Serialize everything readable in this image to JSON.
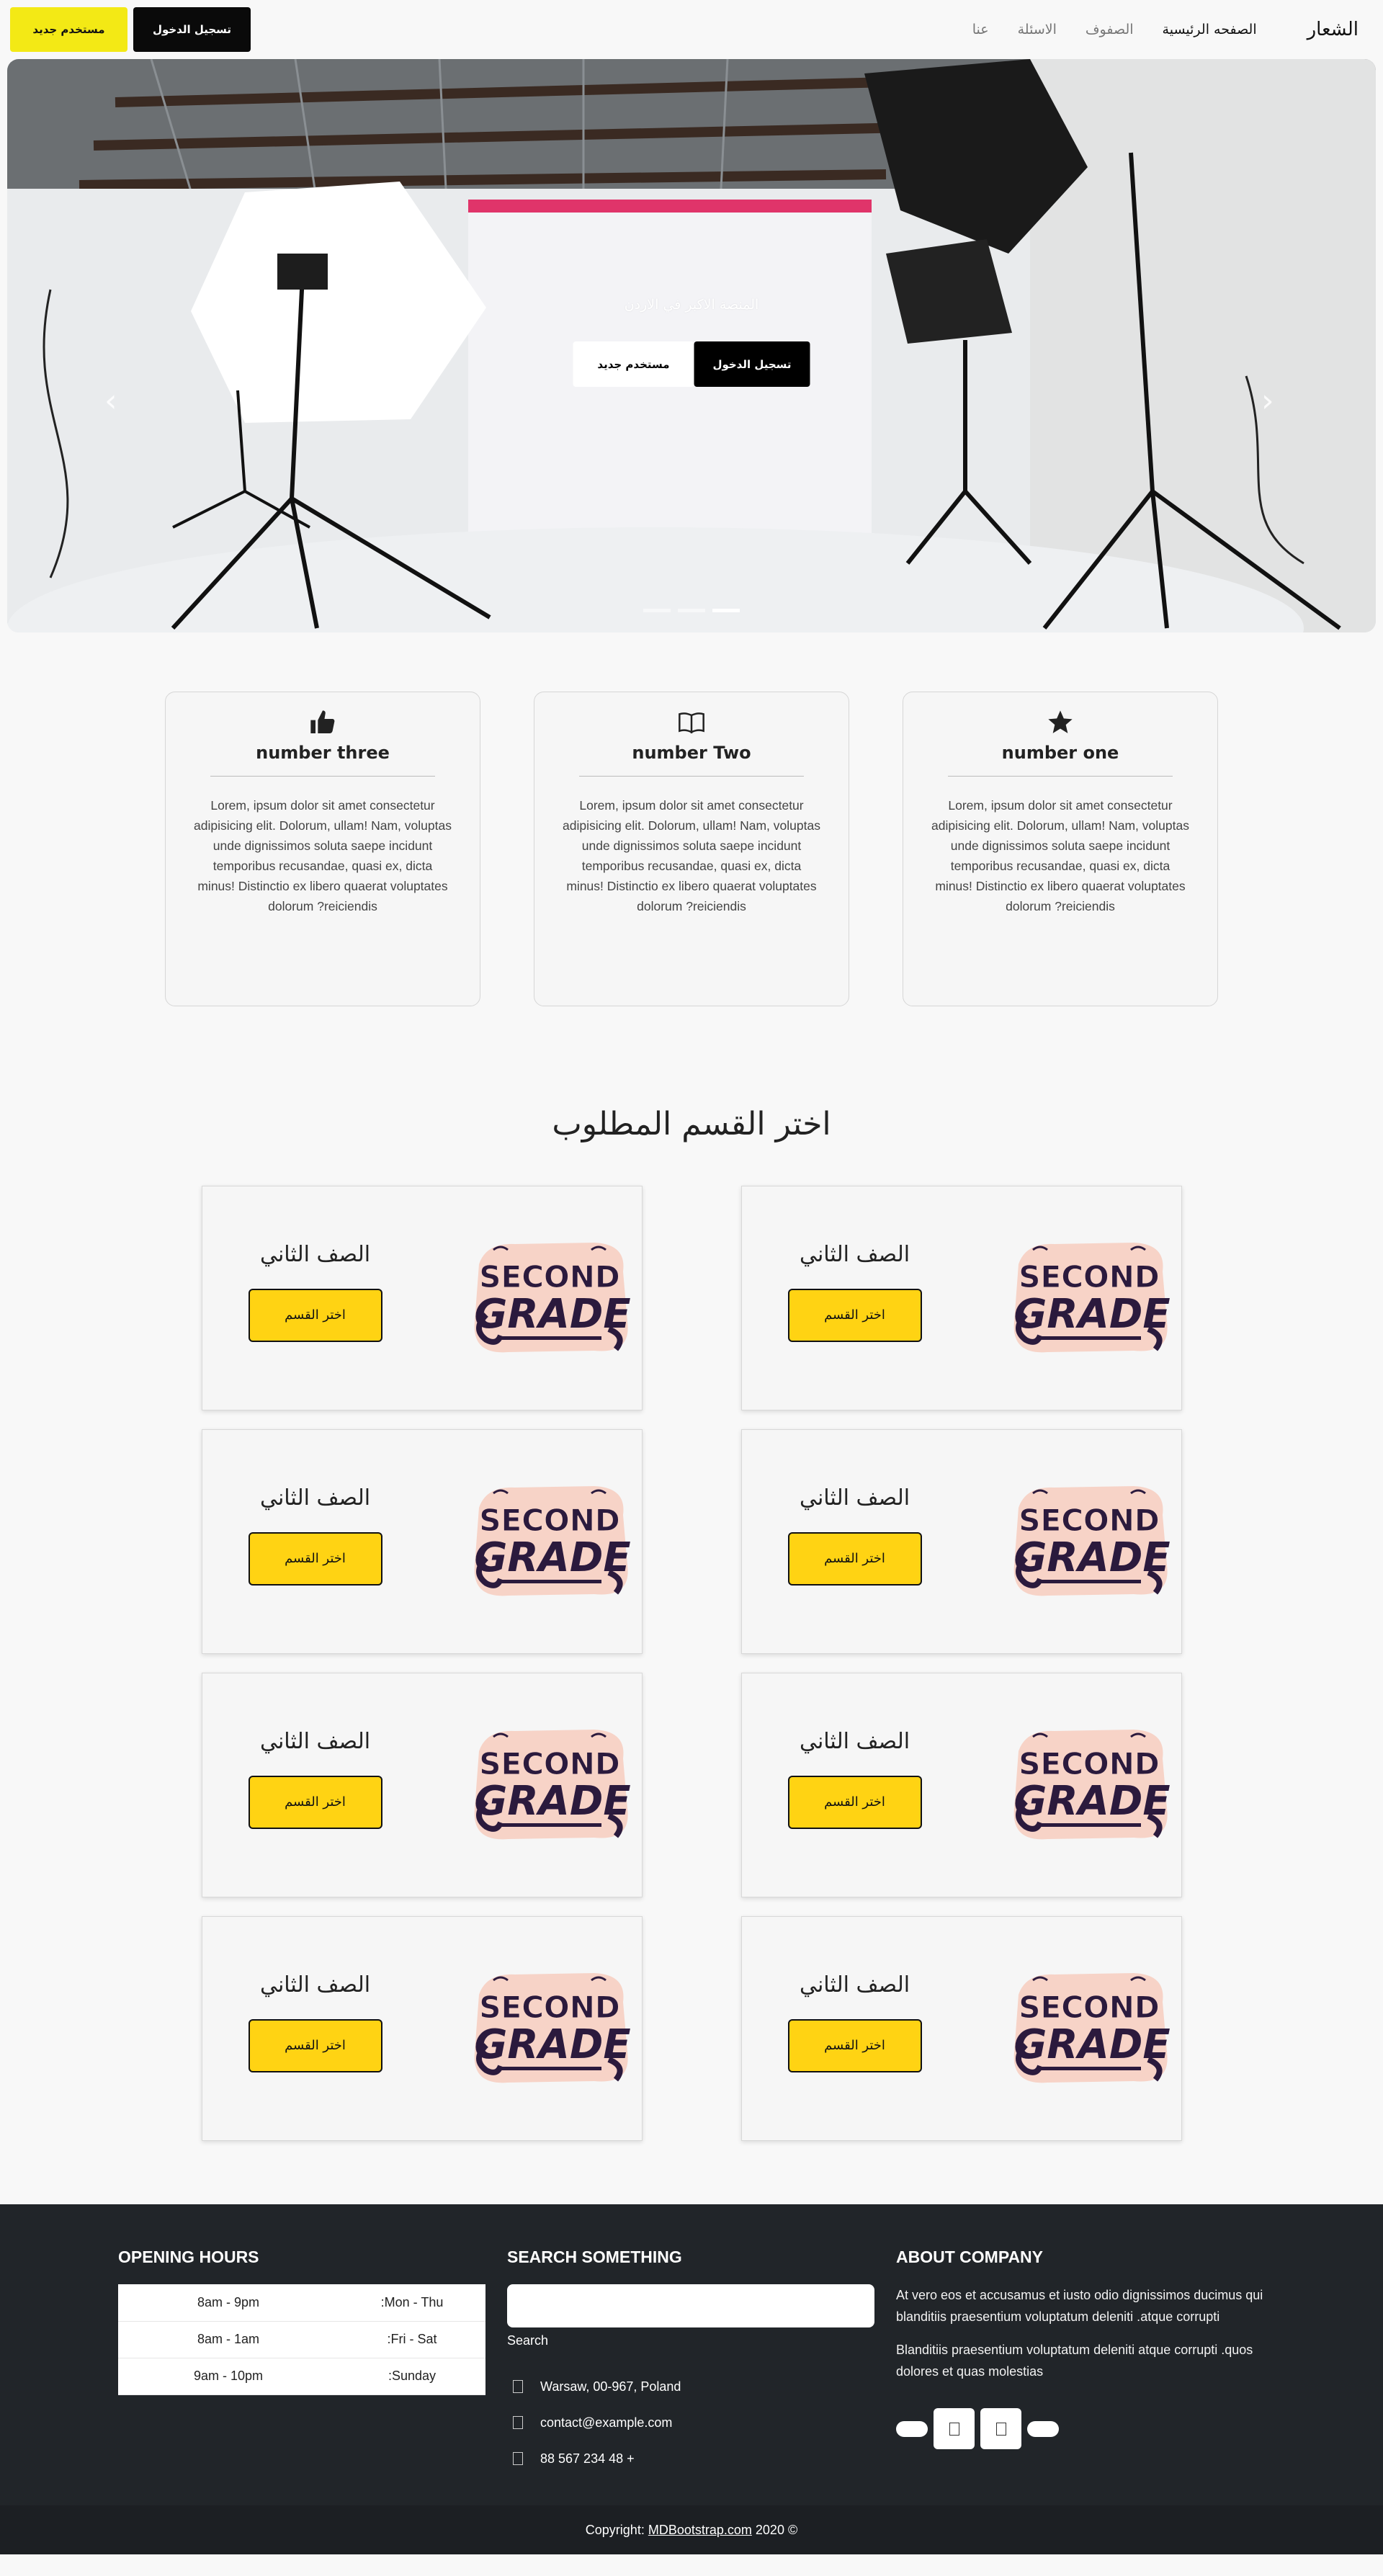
{
  "nav": {
    "brand": "الشعار",
    "links": [
      "الصفحه الرئيسية",
      "الصفوف",
      "الاسئلة",
      "عنا"
    ],
    "signup_label": "مستخدم جديد",
    "login_label": "تسجيل الدخول"
  },
  "hero": {
    "tagline": "المنصة الاكبر في الاردن",
    "login_label": "تسجيل الدخول",
    "signup_label": "مستخدم جديد",
    "slide_count": 3,
    "active_slide": 3
  },
  "features": [
    {
      "icon": "star-icon",
      "title": "number one",
      "text": "Lorem, ipsum dolor sit amet consectetur adipisicing elit. Dolorum, ullam! Nam, voluptas unde dignissimos soluta saepe incidunt temporibus recusandae, quasi ex, dicta minus! Distinctio ex libero quaerat voluptates dolorum ?reiciendis"
    },
    {
      "icon": "book-icon",
      "title": "number Two",
      "text": "Lorem, ipsum dolor sit amet consectetur adipisicing elit. Dolorum, ullam! Nam, voluptas unde dignissimos soluta saepe incidunt temporibus recusandae, quasi ex, dicta minus! Distinctio ex libero quaerat voluptates dolorum ?reiciendis"
    },
    {
      "icon": "thumbs-up-icon",
      "title": "number three",
      "text": "Lorem, ipsum dolor sit amet consectetur adipisicing elit. Dolorum, ullam! Nam, voluptas unde dignissimos soluta saepe incidunt temporibus recusandae, quasi ex, dicta minus! Distinctio ex libero quaerat voluptates dolorum ?reiciendis"
    }
  ],
  "section_title": "اختر القسم المطلوب",
  "grades": [
    {
      "name": "الصف الثاني",
      "button": "اختر القسم",
      "sticker_top": "SECOND",
      "sticker_bottom": "GRADE"
    },
    {
      "name": "الصف الثاني",
      "button": "اختر القسم",
      "sticker_top": "SECOND",
      "sticker_bottom": "GRADE"
    },
    {
      "name": "الصف الثاني",
      "button": "اختر القسم",
      "sticker_top": "SECOND",
      "sticker_bottom": "GRADE"
    },
    {
      "name": "الصف الثاني",
      "button": "اختر القسم",
      "sticker_top": "SECOND",
      "sticker_bottom": "GRADE"
    },
    {
      "name": "الصف الثاني",
      "button": "اختر القسم",
      "sticker_top": "SECOND",
      "sticker_bottom": "GRADE"
    },
    {
      "name": "الصف الثاني",
      "button": "اختر القسم",
      "sticker_top": "SECOND",
      "sticker_bottom": "GRADE"
    },
    {
      "name": "الصف الثاني",
      "button": "اختر القسم",
      "sticker_top": "SECOND",
      "sticker_bottom": "GRADE"
    },
    {
      "name": "الصف الثاني",
      "button": "اختر القسم",
      "sticker_top": "SECOND",
      "sticker_bottom": "GRADE"
    }
  ],
  "footer": {
    "hours_heading": "OPENING HOURS",
    "hours": [
      {
        "day": ":Mon - Thu",
        "time": "8am - 9pm"
      },
      {
        "day": ":Fri - Sat",
        "time": "8am - 1am"
      },
      {
        "day": ":Sunday",
        "time": "9am - 10pm"
      }
    ],
    "search_heading": "SEARCH SOMETHING",
    "search_label": "Search",
    "search_value": "",
    "contacts": [
      {
        "icon": "location-icon",
        "text": "Warsaw, 00-967, Poland"
      },
      {
        "icon": "envelope-icon",
        "text": "contact@example.com"
      },
      {
        "icon": "phone-icon",
        "text": "88 567 234 48 +"
      }
    ],
    "about_heading": "ABOUT COMPANY",
    "about_p1": "At vero eos et accusamus et iusto odio dignissimos ducimus qui blanditiis praesentium voluptatum deleniti .atque corrupti",
    "about_p2": "Blanditiis praesentium voluptatum deleniti atque corrupti .quos dolores et quas molestias"
  },
  "copyright": {
    "prefix": "Copyright:",
    "link": "MDBootstrap.com",
    "suffix": "2020 ©"
  },
  "colors": {
    "yellow_nav": "#f3e915",
    "yellow_button": "#ffd313",
    "footer_bg": "#212529",
    "sticker_purple": "#2b1a3d",
    "sticker_pink": "#f7d3c7"
  }
}
